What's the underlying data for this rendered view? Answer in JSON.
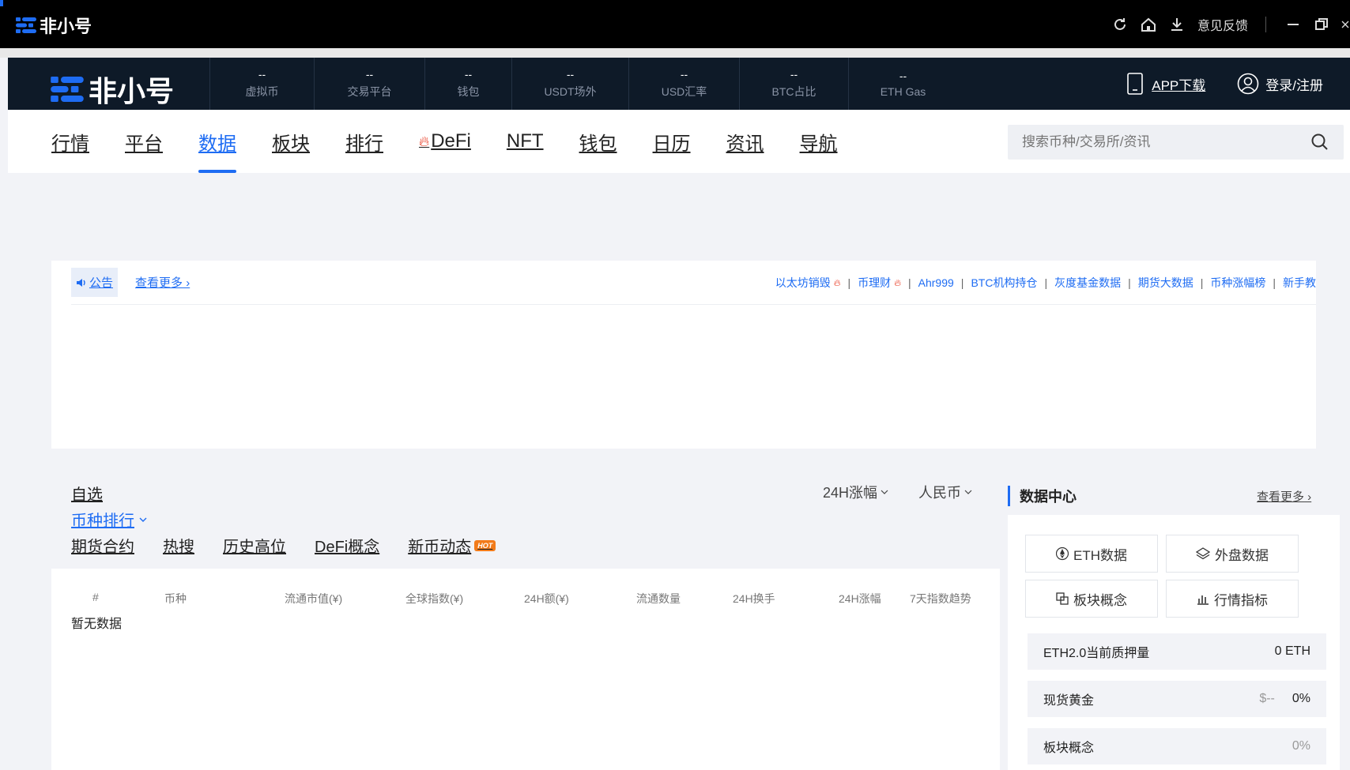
{
  "titlebar": {
    "logo_text": "非小号",
    "feedback": "意见反馈"
  },
  "topnav": {
    "logo_text": "非小号",
    "stats": [
      {
        "value": "--",
        "label": "虚拟币"
      },
      {
        "value": "--",
        "label": "交易平台"
      },
      {
        "value": "--",
        "label": "钱包"
      },
      {
        "value": "--",
        "label": "USDT场外"
      },
      {
        "value": "--",
        "label": "USD汇率"
      },
      {
        "value": "--",
        "label": "BTC占比"
      },
      {
        "value": "--",
        "label": "ETH Gas"
      }
    ],
    "app_download": "APP下载",
    "login": "登录/注册"
  },
  "mainnav": {
    "items": [
      {
        "label": "行情"
      },
      {
        "label": "平台"
      },
      {
        "label": "数据"
      },
      {
        "label": "板块"
      },
      {
        "label": "排行"
      },
      {
        "label": "DeFi"
      },
      {
        "label": "NFT"
      },
      {
        "label": "钱包"
      },
      {
        "label": "日历"
      },
      {
        "label": "资讯"
      },
      {
        "label": "导航"
      }
    ],
    "active_index": 2,
    "search_placeholder": "搜索币种/交易所/资讯"
  },
  "announce": {
    "tag": "公告",
    "more": "查看更多",
    "links": [
      {
        "label": "以太坊销毁",
        "hot": true
      },
      {
        "label": "币理财",
        "hot": true
      },
      {
        "label": "Ahr999",
        "hot": false
      },
      {
        "label": "BTC机构持仓",
        "hot": false
      },
      {
        "label": "灰度基金数据",
        "hot": false
      },
      {
        "label": "期货大数据",
        "hot": false
      },
      {
        "label": "币种涨幅榜",
        "hot": false
      },
      {
        "label": "新手教",
        "hot": false
      }
    ]
  },
  "list": {
    "watchlist": "自选",
    "ranking": "币种排行",
    "tabs": [
      "期货合约",
      "热搜",
      "历史高位",
      "DeFi概念",
      "新币动态"
    ],
    "hot_badge": "HOT",
    "filter_change": "24H涨幅",
    "filter_currency": "人民币",
    "columns": [
      "#",
      "币种",
      "流通市值(¥)",
      "全球指数(¥)",
      "24H额(¥)",
      "流通数量",
      "24H换手",
      "24H涨幅",
      "7天指数趋势"
    ],
    "empty_text": "暂无数据"
  },
  "datacenter": {
    "title": "数据中心",
    "more": "查看更多",
    "buttons": [
      "ETH数据",
      "外盘数据",
      "板块概念",
      "行情指标"
    ],
    "rows": [
      {
        "label": "ETH2.0当前质押量",
        "price": "",
        "value": "0 ETH"
      },
      {
        "label": "现货黄金",
        "price": "$--",
        "value": "0%"
      },
      {
        "label": "板块概念",
        "price": "",
        "value": "0%"
      }
    ]
  },
  "colors": {
    "accent": "#1e6cf3",
    "dark_nav": "#0e1a28",
    "hot": "#f27b1a",
    "fire": "#e8331a"
  }
}
